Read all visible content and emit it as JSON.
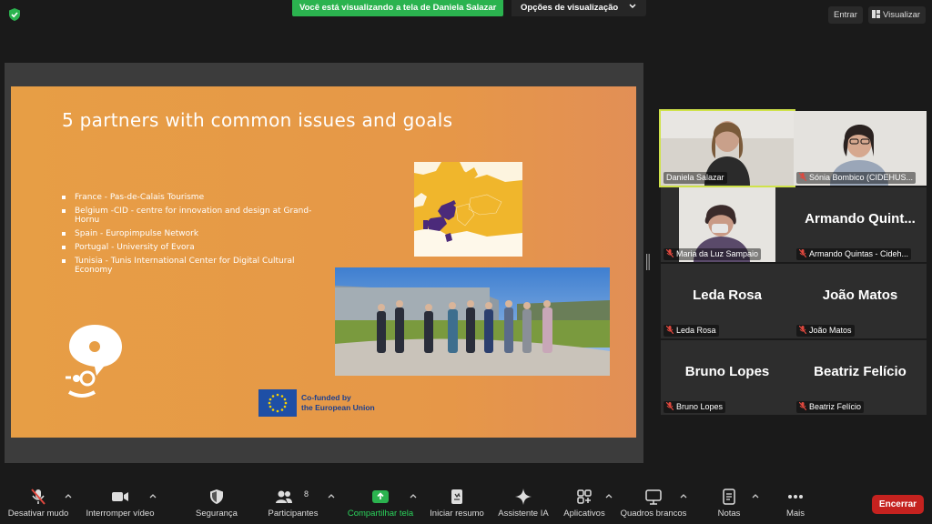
{
  "topbar": {
    "share_banner": "Você está visualizando a tela de Daniela Salazar",
    "view_options": "Opções de visualização",
    "enter": "Entrar",
    "view": "Visualizar"
  },
  "slide": {
    "title": "5 partners with common  issues and goals",
    "partners": [
      "France  - Pas-de-Calais Tourisme",
      "Belgium  -CID - centre for innovation and design at Grand-Hornu",
      "Spain - Europimpulse Network",
      "Portugal  - University of Evora",
      "Tunisia - Tunis International Center for Digital Cultural Economy"
    ],
    "eu_line1": "Co-funded by",
    "eu_line2": "the European Union"
  },
  "participants": [
    {
      "name": "Daniela Salazar",
      "big": "",
      "video": true,
      "muted": false
    },
    {
      "name": "Sónia Bombico (CIDEHUS...",
      "big": "",
      "video": true,
      "muted": true
    },
    {
      "name": "Maria da Luz Sampaio",
      "big": "",
      "video": true,
      "muted": true
    },
    {
      "name": "Armando Quintas - Cideh...",
      "big": "Armando  Quint...",
      "video": false,
      "muted": true
    },
    {
      "name": "Leda Rosa",
      "big": "Leda Rosa",
      "video": false,
      "muted": true
    },
    {
      "name": "João Matos",
      "big": "João Matos",
      "video": false,
      "muted": true
    },
    {
      "name": "Bruno Lopes",
      "big": "Bruno Lopes",
      "video": false,
      "muted": true
    },
    {
      "name": "Beatriz Felício",
      "big": "Beatriz Felício",
      "video": false,
      "muted": true
    }
  ],
  "toolbar": {
    "mute": "Desativar mudo",
    "video": "Interromper vídeo",
    "security": "Segurança",
    "participants": "Participantes",
    "participants_count": "8",
    "share": "Compartilhar tela",
    "summary": "Iniciar resumo",
    "ai": "Assistente IA",
    "apps": "Aplicativos",
    "whiteboards": "Quadros brancos",
    "notes": "Notas",
    "more": "Mais",
    "end": "Encerrar"
  },
  "colors": {
    "share_green": "#2bb34f",
    "end_red": "#c5221f",
    "active_speaker": "#cfe24a",
    "slide_orange": "#e79e45",
    "map_yellow": "#f0b62c",
    "map_purple": "#4b2a7a"
  }
}
